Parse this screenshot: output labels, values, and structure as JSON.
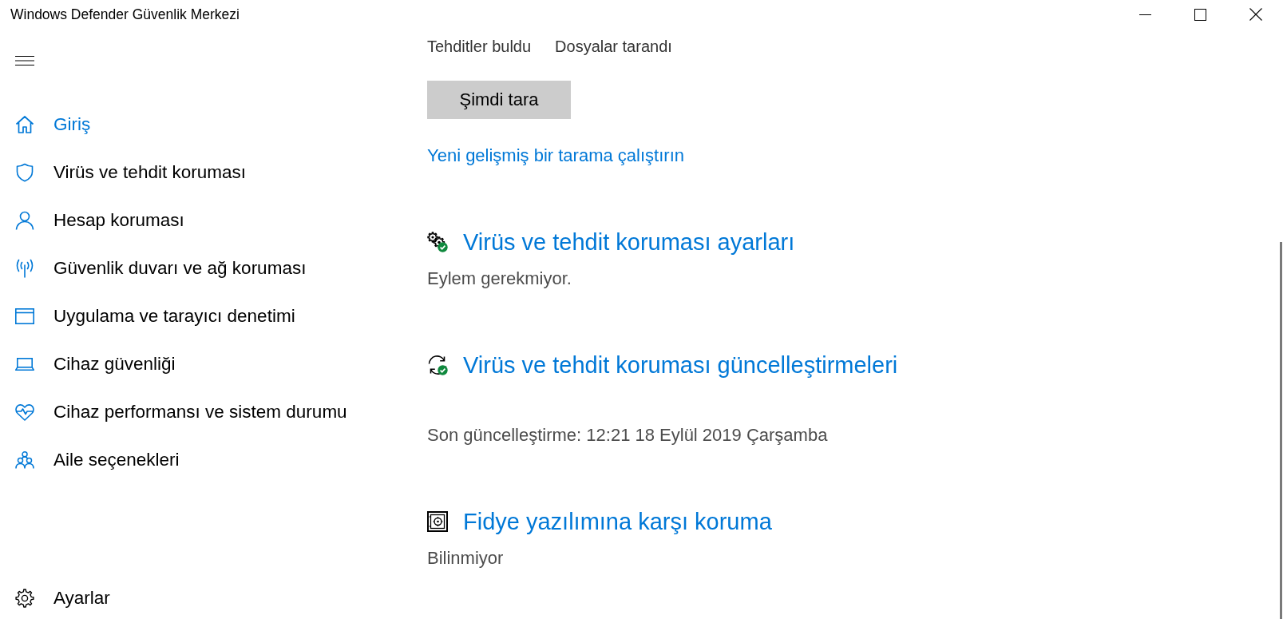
{
  "window": {
    "title": "Windows Defender Güvenlik Merkezi"
  },
  "sidebar": {
    "items": [
      {
        "label": "Giriş",
        "selected": true
      },
      {
        "label": "Virüs ve tehdit koruması",
        "selected": false
      },
      {
        "label": "Hesap koruması",
        "selected": false
      },
      {
        "label": "Güvenlik duvarı ve ağ koruması",
        "selected": false
      },
      {
        "label": "Uygulama ve tarayıcı denetimi",
        "selected": false
      },
      {
        "label": "Cihaz güvenliği",
        "selected": false
      },
      {
        "label": "Cihaz performansı ve sistem durumu",
        "selected": false
      },
      {
        "label": "Aile seçenekleri",
        "selected": false
      }
    ],
    "settings": {
      "label": "Ayarlar",
      "selected": false
    }
  },
  "scan_summary": {
    "labels": [
      "Tehditler buldu",
      "Dosyalar tarandı"
    ]
  },
  "scan_button": {
    "label": "Şimdi tara"
  },
  "advanced_scan_link": {
    "label": "Yeni gelişmiş bir tarama çalıştırın"
  },
  "sections": [
    {
      "title": "Virüs ve tehdit koruması ayarları",
      "status": "Eylem gerekmiyor.",
      "ok": true
    },
    {
      "title": "Virüs ve tehdit koruması güncelleştirmeleri",
      "status": "Son güncelleştirme: 12:21 18 Eylül 2019 Çarşamba",
      "ok": true
    },
    {
      "title": "Fidye yazılımına karşı koruma",
      "status": "Bilinmiyor",
      "ok": false
    }
  ]
}
